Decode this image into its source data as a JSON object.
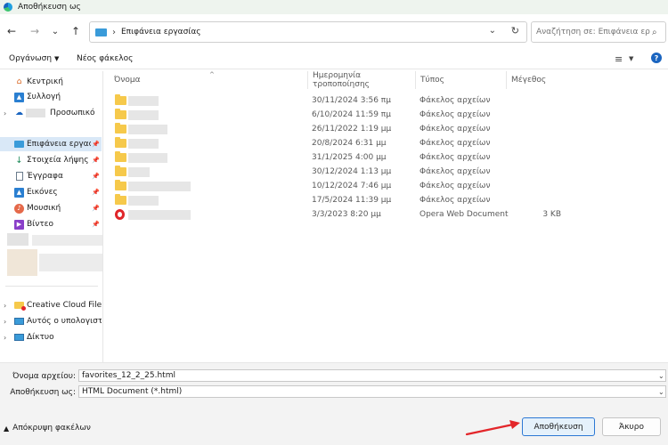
{
  "window": {
    "title": "Αποθήκευση ως"
  },
  "nav": {
    "back_icon": "←",
    "forward_icon": "→",
    "recent_icon": "⌄",
    "up_icon": "↑"
  },
  "address": {
    "separator": "›",
    "path": "Επιφάνεια εργασίας",
    "dropdown_icon": "⌄",
    "refresh_icon": "↻"
  },
  "search": {
    "placeholder": "Αναζήτηση σε: Επιφάνεια εργ..."
  },
  "toolbar": {
    "organize_label": "Οργάνωση",
    "new_folder_label": "Νέος φάκελος",
    "view_icon": "≡",
    "help_label": "?"
  },
  "sidebar": {
    "items": [
      {
        "label": "Κεντρική"
      },
      {
        "label": "Συλλογή"
      },
      {
        "label": "Προσωπικό"
      },
      {
        "label": "Επιφάνεια εργασί"
      },
      {
        "label": "Στοιχεία λήψης"
      },
      {
        "label": "Έγγραφα"
      },
      {
        "label": "Εικόνες"
      },
      {
        "label": "Μουσική"
      },
      {
        "label": "Βίντεο"
      },
      {
        "label": "Creative Cloud Files F"
      },
      {
        "label": "Αυτός ο υπολογιστή"
      },
      {
        "label": "Δίκτυο"
      }
    ]
  },
  "columns": {
    "name": "Όνομα",
    "date": "Ημερομηνία τροποποίησης",
    "type": "Τύπος",
    "size": "Μέγεθος"
  },
  "files": [
    {
      "date": "30/11/2024 3:56 πμ",
      "type": "Φάκελος αρχείων",
      "size": ""
    },
    {
      "date": "6/10/2024 11:59 πμ",
      "type": "Φάκελος αρχείων",
      "size": ""
    },
    {
      "date": "26/11/2022 1:19 μμ",
      "type": "Φάκελος αρχείων",
      "size": ""
    },
    {
      "date": "20/8/2024 6:31 μμ",
      "type": "Φάκελος αρχείων",
      "size": ""
    },
    {
      "date": "31/1/2025 4:00 μμ",
      "type": "Φάκελος αρχείων",
      "size": ""
    },
    {
      "date": "30/12/2024 1:13 μμ",
      "type": "Φάκελος αρχείων",
      "size": ""
    },
    {
      "date": "10/12/2024 7:46 μμ",
      "type": "Φάκελος αρχείων",
      "size": ""
    },
    {
      "date": "17/5/2024 11:39 μμ",
      "type": "Φάκελος αρχείων",
      "size": ""
    },
    {
      "date": "3/3/2023 8:20 μμ",
      "type": "Opera Web Document",
      "size": "3 KB"
    }
  ],
  "form": {
    "filename_label": "Όνομα αρχείου:",
    "filename_value": "favorites_12_2_25.html",
    "savetype_label": "Αποθήκευση ως:",
    "savetype_value": "HTML Document (*.html)"
  },
  "footer": {
    "hide_folders_label": "Απόκρυψη φακέλων",
    "save_label": "Αποθήκευση",
    "cancel_label": "Άκυρο"
  },
  "colors": {
    "accent": "#2c78d4",
    "folder": "#f6c94b",
    "annotation_arrow": "#e3262a"
  }
}
